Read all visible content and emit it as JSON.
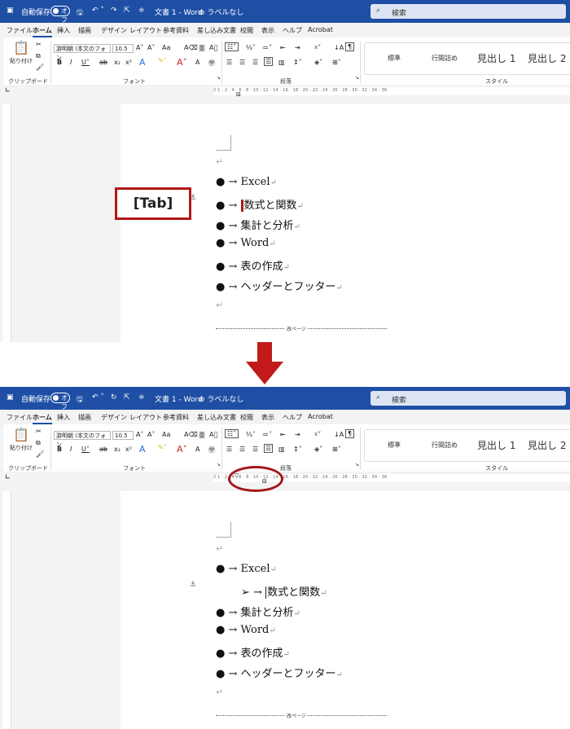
{
  "titlebar": {
    "autosave_label": "自動保存",
    "toggle_state": "オフ",
    "save_icon": "save-icon",
    "doc_title": "文書 1 - Word",
    "sensitivity": "ラベルなし",
    "search_placeholder": "検索"
  },
  "menu": {
    "file": "ファイル",
    "home": "ホーム",
    "insert": "挿入",
    "draw": "描画",
    "design": "デザイン",
    "layout": "レイアウト",
    "references": "参考資料",
    "mailings": "差し込み文書",
    "review": "校閲",
    "view": "表示",
    "help": "ヘルプ",
    "acrobat": "Acrobat"
  },
  "ribbon": {
    "paste": "貼り付け",
    "font_name": "游明朝 (本文のフォン",
    "font_size": "10.5",
    "case": "Aa",
    "clipboard_group": "クリップボード",
    "font_group": "フォント",
    "paragraph_group": "段落",
    "styles_group": "スタイル",
    "styles": [
      "標準",
      "行間詰め",
      "見出し 1",
      "見出し 2"
    ]
  },
  "ruler": {
    "numbers": "2 1 · 2 · 4 · 6 · 8 · 10 · 12 · 14 · 16 · 18 · 20 · 22 · 24 · 26 · 28 · 30 · 32 · 34 · 36"
  },
  "doc_before": [
    {
      "bullet": "●",
      "text": "Excel"
    },
    {
      "bullet": "●",
      "text": "数式と関数"
    },
    {
      "bullet": "●",
      "text": "集計と分析"
    },
    {
      "bullet": "●",
      "text": "Word"
    },
    {
      "bullet": "●",
      "text": "表の作成"
    },
    {
      "bullet": "●",
      "text": "ヘッダーとフッター"
    }
  ],
  "doc_after": [
    {
      "bullet": "●",
      "text": "Excel"
    },
    {
      "bullet": "➢",
      "text": "数式と関数"
    },
    {
      "bullet": "●",
      "text": "集計と分析"
    },
    {
      "bullet": "●",
      "text": "Word"
    },
    {
      "bullet": "●",
      "text": "表の作成"
    },
    {
      "bullet": "●",
      "text": "ヘッダーとフッター"
    }
  ],
  "tab_arrow": "→",
  "para_mark": "↵",
  "page_break": "改ページ",
  "callout": "[Tab]",
  "colors": {
    "titlebar": "#1f4fa5",
    "highlight_red": "#b01818"
  }
}
